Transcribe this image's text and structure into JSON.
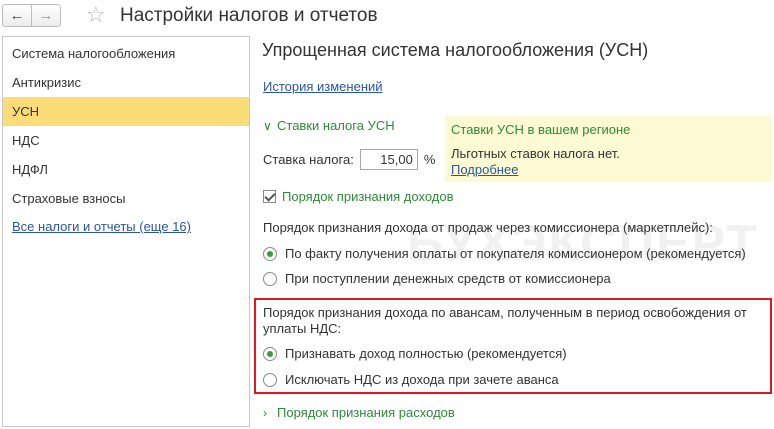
{
  "window": {
    "title": "Настройки налогов и отчетов"
  },
  "sidebar": {
    "items": [
      {
        "label": "Система налогообложения",
        "selected": false
      },
      {
        "label": "Антикризис",
        "selected": false
      },
      {
        "label": "УСН",
        "selected": true
      },
      {
        "label": "НДС",
        "selected": false
      },
      {
        "label": "НДФЛ",
        "selected": false
      },
      {
        "label": "Страховые взносы",
        "selected": false
      }
    ],
    "all_link": "Все налоги и отчеты (еще 16)"
  },
  "main": {
    "heading": "Упрощенная система налогообложения (УСН)",
    "history_link": "История изменений",
    "rates_group": "Ставки налога УСН",
    "rate_label": "Ставка налога:",
    "rate_value": "15,00",
    "rate_unit": "%",
    "info": {
      "title": "Ставки УСН в вашем регионе",
      "text": "Льготных ставок налога нет.",
      "link": "Подробнее"
    },
    "income_group": "Порядок признания доходов",
    "commission_label": "Порядок признания дохода от продаж через комиссионера (маркетплейс):",
    "commission_options": [
      {
        "label": "По факту получения оплаты от покупателя комиссионером (рекомендуется)",
        "selected": true
      },
      {
        "label": "При поступлении денежных средств от комиссионера",
        "selected": false
      }
    ],
    "advance_label_1": "Порядок признания дохода по авансам, полученным в период освобождения от",
    "advance_label_2": "уплаты НДС:",
    "advance_options": [
      {
        "label": "Признавать доход полностью (рекомендуется)",
        "selected": true
      },
      {
        "label": "Исключать НДС из дохода при зачете аванса",
        "selected": false
      }
    ],
    "expenses_group": "Порядок признания расходов"
  },
  "watermark": "БУХЭКСПЕРТ",
  "colors": {
    "selected_bg": "#fadc79",
    "link": "#2a55a8",
    "group_green": "#2f8a3a",
    "info_bg": "#fcfad2",
    "highlight_red": "#e3161e"
  },
  "icons": {
    "back": "arrow-left-icon",
    "forward": "arrow-right-icon",
    "favorite": "star-icon"
  }
}
